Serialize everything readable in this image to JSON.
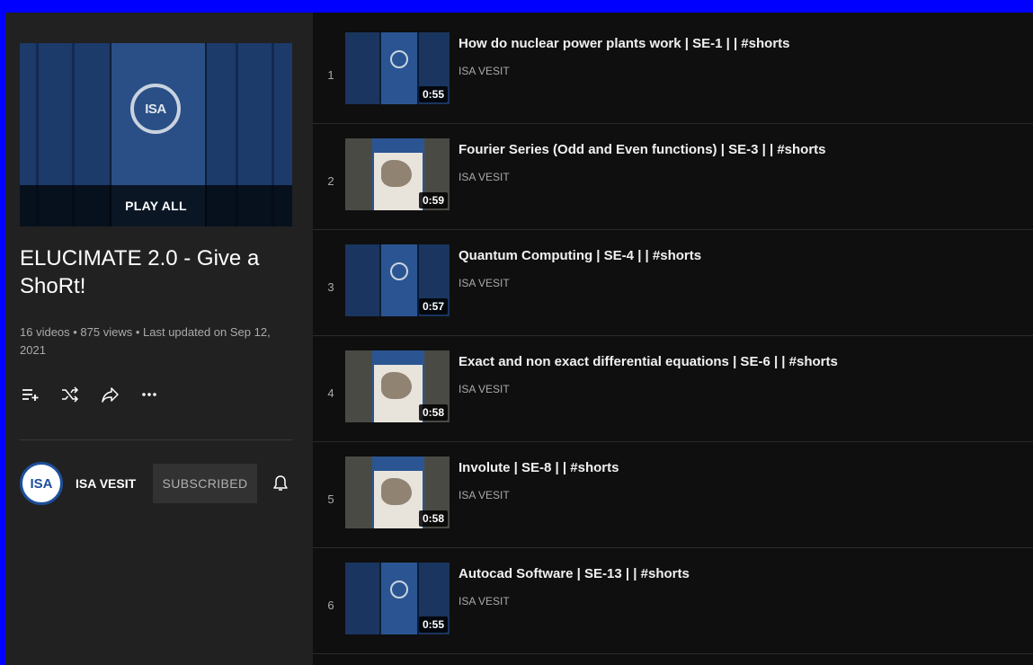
{
  "playlist": {
    "play_all_label": "PLAY ALL",
    "title": "ELUCIMATE 2.0 - Give a ShoRt!",
    "meta": "16 videos • 875 views • Last updated on Sep 12, 2021",
    "hero_logo_text": "ISA",
    "icons": [
      "add-to-queue-icon",
      "shuffle-icon",
      "share-icon",
      "more-icon"
    ]
  },
  "owner": {
    "avatar_text": "ISA",
    "name": "ISA VESIT",
    "subscribe_label": "SUBSCRIBED"
  },
  "videos": [
    {
      "index": "1",
      "title": "How do nuclear power plants work | SE-1 | | #shorts",
      "channel": "ISA VESIT",
      "duration": "0:55",
      "thumb": "logo"
    },
    {
      "index": "2",
      "title": "Fourier Series (Odd and Even functions) | SE-3 | | #shorts",
      "channel": "ISA VESIT",
      "duration": "0:59",
      "thumb": "photo"
    },
    {
      "index": "3",
      "title": "Quantum Computing | SE-4 | | #shorts",
      "channel": "ISA VESIT",
      "duration": "0:57",
      "thumb": "logo"
    },
    {
      "index": "4",
      "title": "Exact and non exact differential equations | SE-6 | | #shorts",
      "channel": "ISA VESIT",
      "duration": "0:58",
      "thumb": "photo"
    },
    {
      "index": "5",
      "title": "Involute | SE-8 | | #shorts",
      "channel": "ISA VESIT",
      "duration": "0:58",
      "thumb": "photo"
    },
    {
      "index": "6",
      "title": "Autocad Software | SE-13 | | #shorts",
      "channel": "ISA VESIT",
      "duration": "0:55",
      "thumb": "logo"
    }
  ],
  "colors": {
    "border": "#0000ff",
    "background": "#0f0f0f",
    "sidebar": "#212121",
    "brand_blue": "#1d4f9a"
  }
}
